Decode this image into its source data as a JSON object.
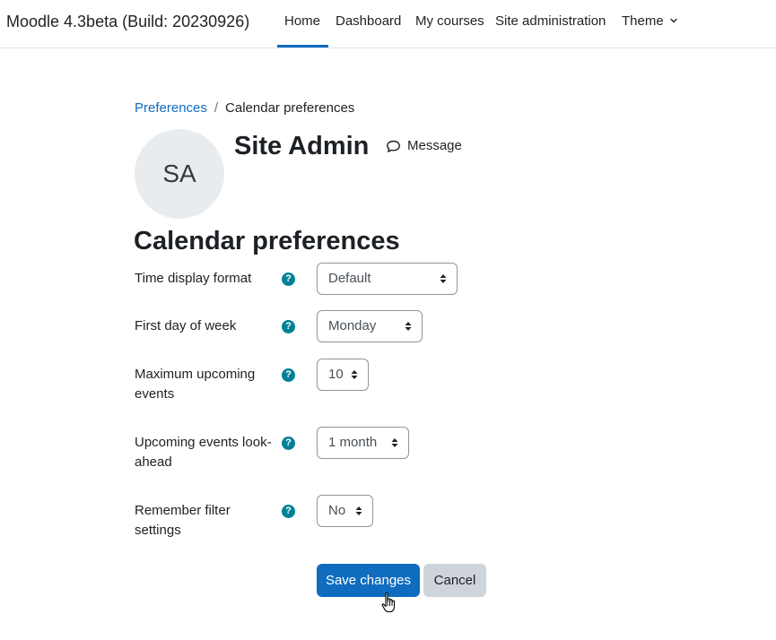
{
  "navbar": {
    "brand": "Moodle 4.3beta (Build: 20230926)",
    "items": [
      {
        "label": "Home",
        "active": true
      },
      {
        "label": "Dashboard"
      },
      {
        "label": "My courses"
      },
      {
        "label": "Site administration"
      },
      {
        "label": "Theme",
        "icon": "chevron-down-icon"
      }
    ],
    "accent_color": "#0f6cbf"
  },
  "breadcrumb": {
    "link": "Preferences",
    "separator": "/",
    "current": "Calendar preferences"
  },
  "user": {
    "initials": "SA",
    "name": "Site Admin",
    "message_label": "Message",
    "message_icon": "speech-bubble-icon"
  },
  "page": {
    "title": "Calendar preferences"
  },
  "form": {
    "help_icon": "question-mark-icon",
    "help_color": "#008196",
    "fields": [
      {
        "label": "Time display format",
        "value": "Default"
      },
      {
        "label": "First day of week",
        "value": "Monday"
      },
      {
        "label": "Maximum upcoming events",
        "value": "10"
      },
      {
        "label": "Upcoming events look-ahead",
        "value": "1 month"
      },
      {
        "label": "Remember filter settings",
        "value": "No"
      }
    ]
  },
  "buttons": {
    "save": "Save changes",
    "cancel": "Cancel",
    "save_color": "#0f6cbf"
  }
}
